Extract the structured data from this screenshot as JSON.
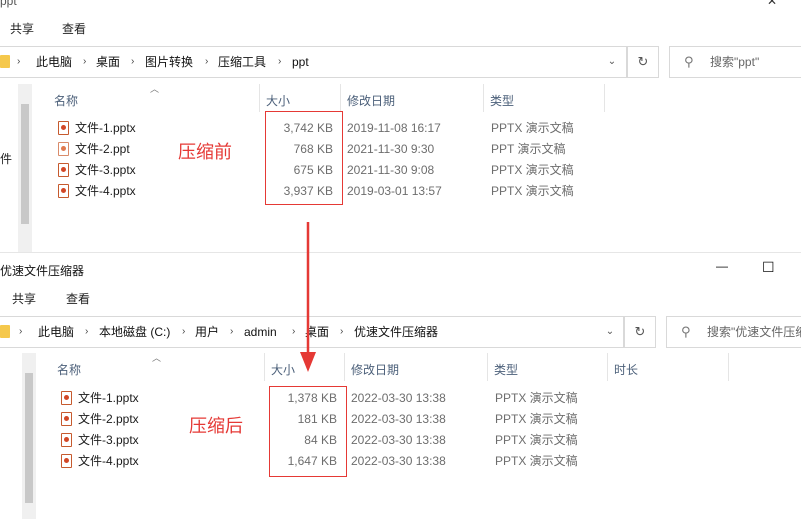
{
  "top_window": {
    "title_fragment": "ppt",
    "ribbon_tabs": [
      "共享",
      "查看"
    ],
    "breadcrumb": [
      "此电脑",
      "桌面",
      "图片转换",
      "压缩工具",
      "ppt"
    ],
    "search_placeholder": "搜索\"ppt\"",
    "columns": {
      "name": "名称",
      "size": "大小",
      "modified": "修改日期",
      "type": "类型"
    },
    "left_pane_fragment": "件",
    "files": [
      {
        "name": "文件-1.pptx",
        "size": "3,742 KB",
        "modified": "2019-11-08 16:17",
        "type": "PPTX 演示文稿",
        "icon": "pptx-file-icon"
      },
      {
        "name": "文件-2.ppt",
        "size": "768 KB",
        "modified": "2021-11-30 9:30",
        "type": "PPT 演示文稿",
        "icon": "ppt-file-icon"
      },
      {
        "name": "文件-3.pptx",
        "size": "675 KB",
        "modified": "2021-11-30 9:08",
        "type": "PPTX 演示文稿",
        "icon": "pptx-file-icon"
      },
      {
        "name": "文件-4.pptx",
        "size": "3,937 KB",
        "modified": "2019-03-01 13:57",
        "type": "PPTX 演示文稿",
        "icon": "pptx-file-icon"
      }
    ],
    "annotation": "压缩前"
  },
  "bottom_window": {
    "title": "优速文件压缩器",
    "ribbon_tabs": [
      "共享",
      "查看"
    ],
    "breadcrumb": [
      "此电脑",
      "本地磁盘 (C:)",
      "用户",
      "admin",
      "桌面",
      "优速文件压缩器"
    ],
    "search_placeholder": "搜索\"优速文件压缩",
    "columns": {
      "name": "名称",
      "size": "大小",
      "modified": "修改日期",
      "type": "类型",
      "duration": "时长"
    },
    "files": [
      {
        "name": "文件-1.pptx",
        "size": "1,378 KB",
        "modified": "2022-03-30 13:38",
        "type": "PPTX 演示文稿",
        "icon": "pptx-file-icon"
      },
      {
        "name": "文件-2.pptx",
        "size": "181 KB",
        "modified": "2022-03-30 13:38",
        "type": "PPTX 演示文稿",
        "icon": "pptx-file-icon"
      },
      {
        "name": "文件-3.pptx",
        "size": "84 KB",
        "modified": "2022-03-30 13:38",
        "type": "PPTX 演示文稿",
        "icon": "pptx-file-icon"
      },
      {
        "name": "文件-4.pptx",
        "size": "1,647 KB",
        "modified": "2022-03-30 13:38",
        "type": "PPTX 演示文稿",
        "icon": "pptx-file-icon"
      }
    ],
    "annotation": "压缩后",
    "window_controls": {
      "minimize": "—",
      "maximize": "☐"
    }
  },
  "colors": {
    "annotation_red": "#e53935",
    "header_text": "#4c607a",
    "muted_text": "#6d6d6d"
  }
}
